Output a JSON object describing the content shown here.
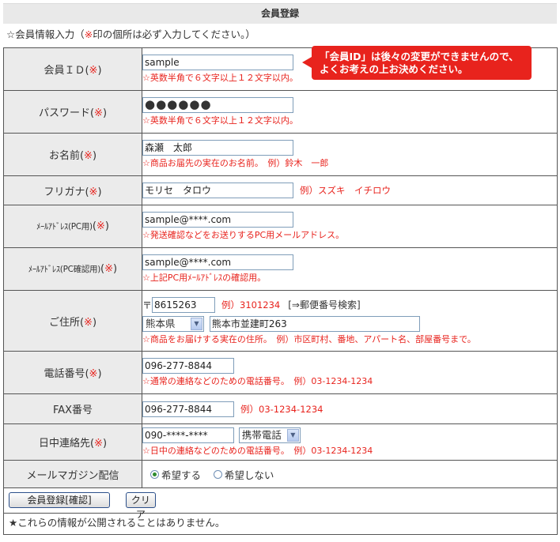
{
  "header": {
    "title": "会員登録"
  },
  "intro": {
    "prefix": "☆会員情報入力（",
    "mark": "※",
    "suffix": "印の個所は必ず入力してください。）"
  },
  "required_mark": "※",
  "tooltip": {
    "line1": "「会員ID」は後々の変更ができませんので、",
    "line2": "よくお考えの上お決めください。"
  },
  "fields": {
    "member_id": {
      "label": "会員ＩＤ",
      "value": "sample",
      "note": "☆英数半角で６文字以上１２文字以内。"
    },
    "password": {
      "label": "パスワード",
      "value": "●●●●●●",
      "note": "☆英数半角で６文字以上１２文字以内。"
    },
    "name": {
      "label": "お名前",
      "value": "森瀬　太郎",
      "note": "☆商品お届先の実在のお名前。　例）鈴木　一郎"
    },
    "furigana": {
      "label": "フリガナ",
      "value": "モリセ　タロウ",
      "note": "例）スズキ　イチロウ"
    },
    "email_pc": {
      "label": "ﾒｰﾙｱﾄﾞﾚｽ(PC用)",
      "value": "sample@****.com",
      "note": "☆発送確認などをお送りするPC用メールアドレス。"
    },
    "email_pc_confirm": {
      "label": "ﾒｰﾙｱﾄﾞﾚｽ(PC確認用)",
      "value": "sample@****.com",
      "note": "☆上記PC用ﾒｰﾙｱﾄﾞﾚｽの確認用。"
    },
    "address": {
      "label": "ご住所",
      "zip_prefix": "〒",
      "zip_value": "8615263",
      "zip_example": "例）3101234",
      "zip_search": "[⇒郵便番号検索]",
      "prefecture": "熊本県",
      "city_value": "熊本市並建町263",
      "note": "☆商品をお届けする実在の住所。　例）市区町村、番地、アパート名、部屋番号まで。"
    },
    "phone": {
      "label": "電話番号",
      "value": "096-277-8844",
      "note": "☆通常の連絡などのための電話番号。　例）03-1234-1234"
    },
    "fax": {
      "label": "FAX番号",
      "value": "096-277-8844",
      "note": "例）03-1234-1234"
    },
    "daytime_contact": {
      "label": "日中連絡先",
      "value": "090-****-****",
      "type": "携帯電話",
      "note": "☆日中の連絡などのための電話番号。　例）03-1234-1234"
    },
    "newsletter": {
      "label": "メールマガジン配信",
      "option_yes": "希望する",
      "option_no": "希望しない",
      "selected": "希望する"
    }
  },
  "buttons": {
    "submit": "会員登録[確認]",
    "clear": "クリア"
  },
  "footer": {
    "text": "★これらの情報が公開されることはありません。"
  },
  "colors": {
    "required": "#e8231d",
    "label_bg": "#ebebeb",
    "title_bg": "#e9e9e9",
    "tooltip_bg": "#e8231d"
  }
}
